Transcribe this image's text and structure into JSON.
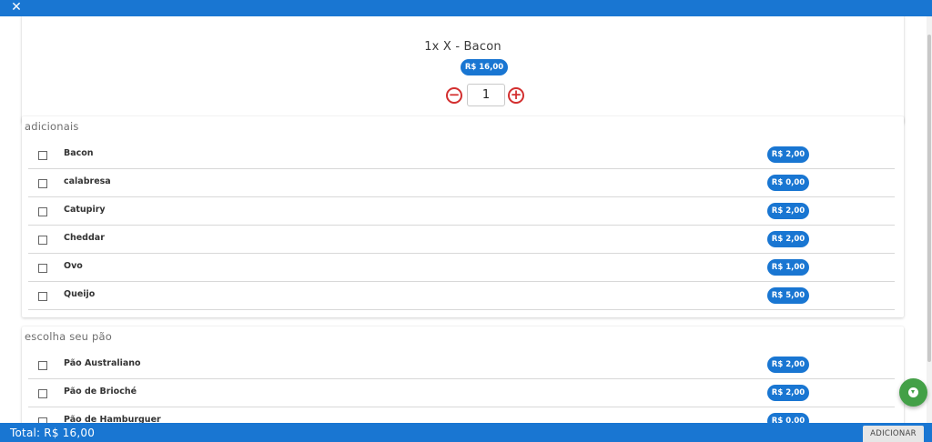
{
  "header": {
    "close_label": "✕"
  },
  "product": {
    "title": "1x X - Bacon",
    "price": "R$ 16,00",
    "quantity": "1"
  },
  "stepper": {
    "minus": "−",
    "plus": "+"
  },
  "sections": [
    {
      "title": "adicionais",
      "items": [
        {
          "name": "Bacon",
          "price": "R$ 2,00"
        },
        {
          "name": "calabresa",
          "price": "R$ 0,00"
        },
        {
          "name": "Catupiry",
          "price": "R$ 2,00"
        },
        {
          "name": "Cheddar",
          "price": "R$ 2,00"
        },
        {
          "name": "Ovo",
          "price": "R$ 1,00"
        },
        {
          "name": "Queijo",
          "price": "R$ 5,00"
        }
      ]
    },
    {
      "title": "escolha seu pão",
      "items": [
        {
          "name": "Pão Australiano",
          "price": "R$ 2,00"
        },
        {
          "name": "Pão de Brioché",
          "price": "R$ 2,00"
        },
        {
          "name": "Pão de Hamburguer",
          "price": "R$ 0,00"
        }
      ]
    }
  ],
  "footer": {
    "total": "Total: R$ 16,00",
    "add_label": "ADICIONAR"
  },
  "colors": {
    "primary": "#1976d2",
    "danger": "#d32f2f",
    "fab": "#43a047"
  }
}
